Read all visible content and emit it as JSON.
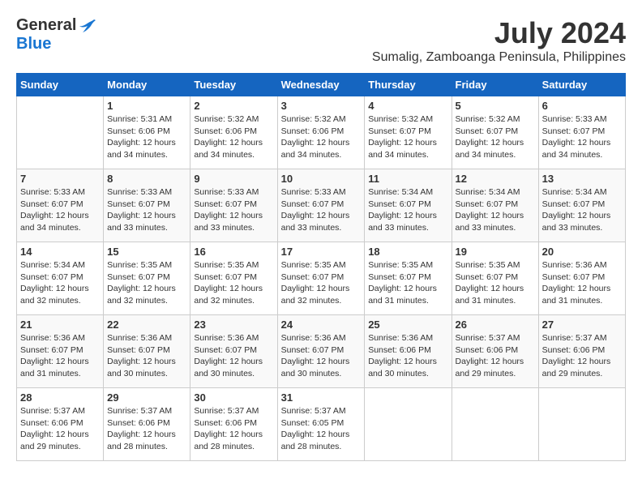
{
  "header": {
    "logo_general": "General",
    "logo_blue": "Blue",
    "month_year": "July 2024",
    "location": "Sumalig, Zamboanga Peninsula, Philippines"
  },
  "calendar": {
    "days_of_week": [
      "Sunday",
      "Monday",
      "Tuesday",
      "Wednesday",
      "Thursday",
      "Friday",
      "Saturday"
    ],
    "weeks": [
      [
        {
          "date": "",
          "info": ""
        },
        {
          "date": "1",
          "info": "Sunrise: 5:31 AM\nSunset: 6:06 PM\nDaylight: 12 hours\nand 34 minutes."
        },
        {
          "date": "2",
          "info": "Sunrise: 5:32 AM\nSunset: 6:06 PM\nDaylight: 12 hours\nand 34 minutes."
        },
        {
          "date": "3",
          "info": "Sunrise: 5:32 AM\nSunset: 6:06 PM\nDaylight: 12 hours\nand 34 minutes."
        },
        {
          "date": "4",
          "info": "Sunrise: 5:32 AM\nSunset: 6:07 PM\nDaylight: 12 hours\nand 34 minutes."
        },
        {
          "date": "5",
          "info": "Sunrise: 5:32 AM\nSunset: 6:07 PM\nDaylight: 12 hours\nand 34 minutes."
        },
        {
          "date": "6",
          "info": "Sunrise: 5:33 AM\nSunset: 6:07 PM\nDaylight: 12 hours\nand 34 minutes."
        }
      ],
      [
        {
          "date": "7",
          "info": "Sunrise: 5:33 AM\nSunset: 6:07 PM\nDaylight: 12 hours\nand 34 minutes."
        },
        {
          "date": "8",
          "info": "Sunrise: 5:33 AM\nSunset: 6:07 PM\nDaylight: 12 hours\nand 33 minutes."
        },
        {
          "date": "9",
          "info": "Sunrise: 5:33 AM\nSunset: 6:07 PM\nDaylight: 12 hours\nand 33 minutes."
        },
        {
          "date": "10",
          "info": "Sunrise: 5:33 AM\nSunset: 6:07 PM\nDaylight: 12 hours\nand 33 minutes."
        },
        {
          "date": "11",
          "info": "Sunrise: 5:34 AM\nSunset: 6:07 PM\nDaylight: 12 hours\nand 33 minutes."
        },
        {
          "date": "12",
          "info": "Sunrise: 5:34 AM\nSunset: 6:07 PM\nDaylight: 12 hours\nand 33 minutes."
        },
        {
          "date": "13",
          "info": "Sunrise: 5:34 AM\nSunset: 6:07 PM\nDaylight: 12 hours\nand 33 minutes."
        }
      ],
      [
        {
          "date": "14",
          "info": "Sunrise: 5:34 AM\nSunset: 6:07 PM\nDaylight: 12 hours\nand 32 minutes."
        },
        {
          "date": "15",
          "info": "Sunrise: 5:35 AM\nSunset: 6:07 PM\nDaylight: 12 hours\nand 32 minutes."
        },
        {
          "date": "16",
          "info": "Sunrise: 5:35 AM\nSunset: 6:07 PM\nDaylight: 12 hours\nand 32 minutes."
        },
        {
          "date": "17",
          "info": "Sunrise: 5:35 AM\nSunset: 6:07 PM\nDaylight: 12 hours\nand 32 minutes."
        },
        {
          "date": "18",
          "info": "Sunrise: 5:35 AM\nSunset: 6:07 PM\nDaylight: 12 hours\nand 31 minutes."
        },
        {
          "date": "19",
          "info": "Sunrise: 5:35 AM\nSunset: 6:07 PM\nDaylight: 12 hours\nand 31 minutes."
        },
        {
          "date": "20",
          "info": "Sunrise: 5:36 AM\nSunset: 6:07 PM\nDaylight: 12 hours\nand 31 minutes."
        }
      ],
      [
        {
          "date": "21",
          "info": "Sunrise: 5:36 AM\nSunset: 6:07 PM\nDaylight: 12 hours\nand 31 minutes."
        },
        {
          "date": "22",
          "info": "Sunrise: 5:36 AM\nSunset: 6:07 PM\nDaylight: 12 hours\nand 30 minutes."
        },
        {
          "date": "23",
          "info": "Sunrise: 5:36 AM\nSunset: 6:07 PM\nDaylight: 12 hours\nand 30 minutes."
        },
        {
          "date": "24",
          "info": "Sunrise: 5:36 AM\nSunset: 6:07 PM\nDaylight: 12 hours\nand 30 minutes."
        },
        {
          "date": "25",
          "info": "Sunrise: 5:36 AM\nSunset: 6:06 PM\nDaylight: 12 hours\nand 30 minutes."
        },
        {
          "date": "26",
          "info": "Sunrise: 5:37 AM\nSunset: 6:06 PM\nDaylight: 12 hours\nand 29 minutes."
        },
        {
          "date": "27",
          "info": "Sunrise: 5:37 AM\nSunset: 6:06 PM\nDaylight: 12 hours\nand 29 minutes."
        }
      ],
      [
        {
          "date": "28",
          "info": "Sunrise: 5:37 AM\nSunset: 6:06 PM\nDaylight: 12 hours\nand 29 minutes."
        },
        {
          "date": "29",
          "info": "Sunrise: 5:37 AM\nSunset: 6:06 PM\nDaylight: 12 hours\nand 28 minutes."
        },
        {
          "date": "30",
          "info": "Sunrise: 5:37 AM\nSunset: 6:06 PM\nDaylight: 12 hours\nand 28 minutes."
        },
        {
          "date": "31",
          "info": "Sunrise: 5:37 AM\nSunset: 6:05 PM\nDaylight: 12 hours\nand 28 minutes."
        },
        {
          "date": "",
          "info": ""
        },
        {
          "date": "",
          "info": ""
        },
        {
          "date": "",
          "info": ""
        }
      ]
    ]
  }
}
